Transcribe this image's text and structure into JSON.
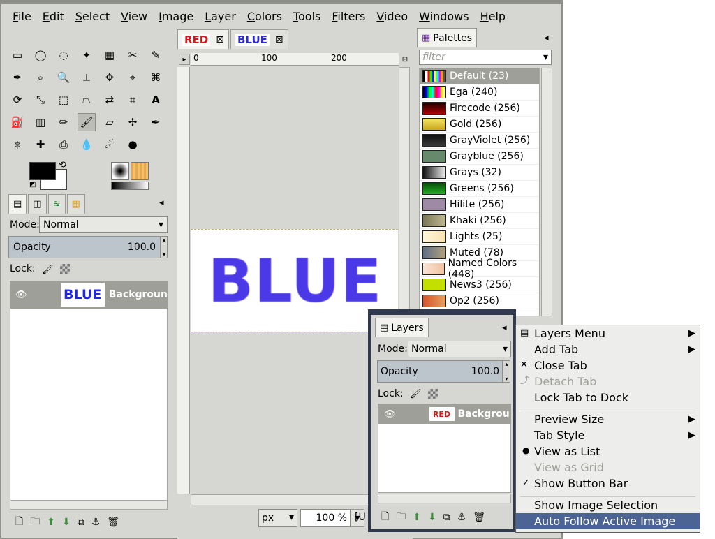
{
  "menubar": {
    "items": [
      "File",
      "Edit",
      "Select",
      "View",
      "Image",
      "Layer",
      "Colors",
      "Tools",
      "Filters",
      "Video",
      "Windows",
      "Help"
    ]
  },
  "tool_panel": {
    "mode_label": "Mode:",
    "mode_value": "Normal",
    "opacity_label": "Opacity",
    "opacity_value": "100.0",
    "lock_label": "Lock:",
    "layer_name": "Backgroun"
  },
  "image_tabs": {
    "tab1": "RED",
    "tab2": "BLUE"
  },
  "ruler": {
    "labels": [
      "0",
      "100",
      "200"
    ]
  },
  "canvas": {
    "text": "BLUE"
  },
  "status_bar": {
    "unit": "px",
    "zoom": "100 %",
    "right_text": "[U"
  },
  "palettes": {
    "tab_label": "Palettes",
    "filter_placeholder": "filter",
    "items": [
      {
        "name": "Default (23)",
        "color": "#e6a000"
      },
      {
        "name": "Ega (240)",
        "color": "#ff00ff"
      },
      {
        "name": "Firecode (256)",
        "color": "#8a0000"
      },
      {
        "name": "Gold (256)",
        "color": "#d7c41d"
      },
      {
        "name": "GrayViolet (256)",
        "color": "#2b2b2b"
      },
      {
        "name": "Grayblue (256)",
        "color": "#688368"
      },
      {
        "name": "Grays (32)",
        "color": "#9a9a9a"
      },
      {
        "name": "Greens (256)",
        "color": "#169016"
      },
      {
        "name": "Hilite (256)",
        "color": "#9c8ea6"
      },
      {
        "name": "Khaki (256)",
        "color": "#a49d75"
      },
      {
        "name": "Lights (25)",
        "color": "#f2eaa6"
      },
      {
        "name": "Muted (78)",
        "color": "#7b8b9d"
      },
      {
        "name": "Named Colors (448)",
        "color": "#f3d8c4"
      },
      {
        "name": "News3 (256)",
        "color": "#c6e000"
      },
      {
        "name": "Op2 (256)",
        "color": "#d05a2f"
      }
    ]
  },
  "layers_window": {
    "tab_label": "Layers",
    "mode_label": "Mode:",
    "mode_value": "Normal",
    "opacity_label": "Opacity",
    "opacity_value": "100.0",
    "lock_label": "Lock:",
    "layer_name": "Backgrou",
    "thumb_text": "RED"
  },
  "context_menu": {
    "items": [
      {
        "label": "Layers Menu",
        "type": "submenu"
      },
      {
        "label": "Add Tab",
        "type": "submenu"
      },
      {
        "label": "Close Tab",
        "type": "normal"
      },
      {
        "label": "Detach Tab",
        "type": "disabled"
      },
      {
        "label": "Lock Tab to Dock",
        "type": "normal"
      },
      {
        "label": "Preview Size",
        "type": "submenu"
      },
      {
        "label": "Tab Style",
        "type": "submenu"
      },
      {
        "label": "View as List",
        "type": "radio"
      },
      {
        "label": "View as Grid",
        "type": "disabled"
      },
      {
        "label": "Show Button Bar",
        "type": "check"
      },
      {
        "label": "Show Image Selection",
        "type": "normal"
      },
      {
        "label": "Auto Follow Active Image",
        "type": "highlight"
      }
    ]
  }
}
